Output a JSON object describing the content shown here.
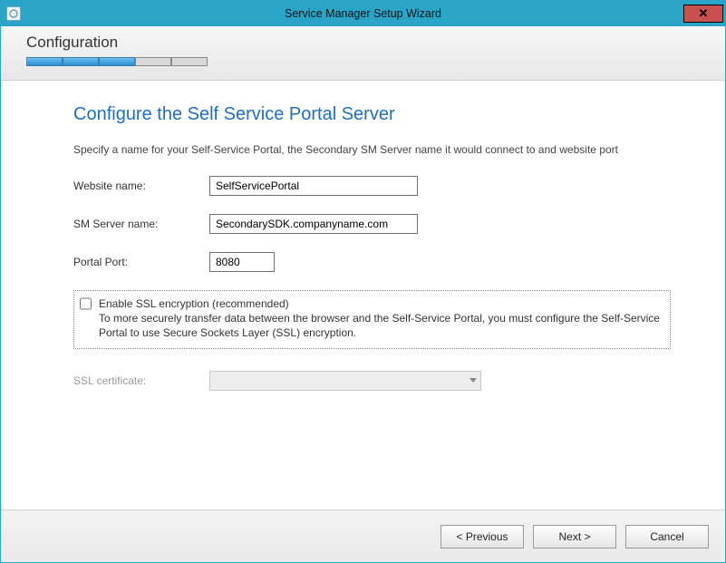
{
  "window": {
    "title": "Service Manager Setup Wizard"
  },
  "header": {
    "section": "Configuration"
  },
  "page": {
    "title": "Configure the Self Service Portal Server",
    "description": "Specify a name for your Self-Service Portal, the Secondary SM Server name it would connect to and website port"
  },
  "form": {
    "website_label": "Website name:",
    "website_value": "SelfServicePortal",
    "smserver_label": "SM Server name:",
    "smserver_value": "SecondarySDK.companyname.com",
    "port_label": "Portal Port:",
    "port_value": "8080"
  },
  "ssl": {
    "checkbox_label": "Enable SSL encryption (recommended)",
    "explain": "To more securely transfer data between the browser and the Self-Service Portal, you must configure the Self-Service Portal to use Secure Sockets Layer (SSL) encryption.",
    "cert_label": "SSL certificate:",
    "checked": false
  },
  "buttons": {
    "previous": "< Previous",
    "next": "Next >",
    "cancel": "Cancel"
  }
}
